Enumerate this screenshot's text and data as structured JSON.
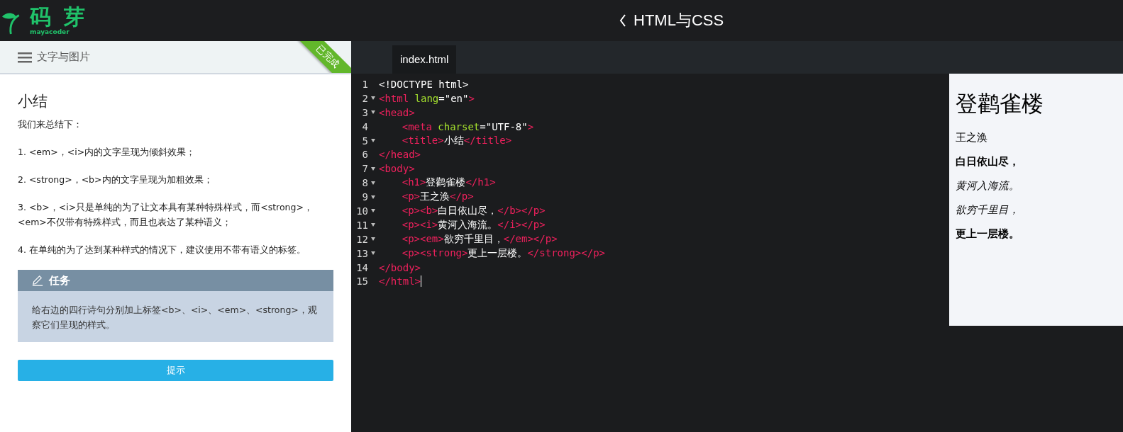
{
  "header": {
    "logo": {
      "name": "码 芽",
      "subtitle": "mayacoder"
    },
    "title": "HTML与CSS"
  },
  "lesson": {
    "menu_title": "文字与图片",
    "completed": true,
    "ribbon": "已完成",
    "heading": "小结",
    "paragraphs": [
      "我们来总结下：",
      "1. <em>，<i>内的文字呈现为倾斜效果；",
      "2. <strong>，<b>内的文字呈现为加粗效果；",
      "3. <b>，<i>只是单纯的为了让文本具有某种特殊样式，而<strong>，<em>不仅带有特殊样式，而且也表达了某种语义；",
      "4. 在单纯的为了达到某种样式的情况下，建议使用不带有语义的标签。"
    ],
    "task": {
      "title": "任务",
      "text": "给右边的四行诗句分别加上标签<b>、<i>、<em>、<strong>，观察它们呈现的样式。"
    },
    "hint_button": "提示"
  },
  "editor": {
    "tabs": [
      {
        "label": "index.html",
        "selected": true
      }
    ],
    "lines": [
      {
        "number": "1",
        "foldable": false,
        "indented": false,
        "tokens": [
          {
            "kind": "plain",
            "text": "<!DOCTYPE html>"
          }
        ]
      },
      {
        "number": "2",
        "foldable": true,
        "indented": false,
        "tokens": [
          {
            "kind": "tag",
            "text": "<html"
          },
          {
            "kind": "attr",
            "text": "lang"
          },
          {
            "kind": "plain",
            "text": "=\"en\""
          },
          {
            "kind": "tag",
            "text": ">"
          }
        ]
      },
      {
        "number": "3",
        "foldable": true,
        "indented": false,
        "tokens": [
          {
            "kind": "tag",
            "text": "<head>"
          }
        ]
      },
      {
        "number": "4",
        "foldable": false,
        "indented": true,
        "tokens": [
          {
            "kind": "tag",
            "text": "<meta"
          },
          {
            "kind": "attr",
            "text": "charset"
          },
          {
            "kind": "plain",
            "text": "=\"UTF-8\""
          },
          {
            "kind": "tag",
            "text": ">"
          }
        ]
      },
      {
        "number": "5",
        "foldable": true,
        "indented": true,
        "tokens": [
          {
            "kind": "tag",
            "text": "<title>"
          },
          {
            "kind": "plain",
            "text": "小结"
          },
          {
            "kind": "tag",
            "text": "</title>"
          }
        ]
      },
      {
        "number": "6",
        "foldable": false,
        "indented": false,
        "tokens": [
          {
            "kind": "tag",
            "text": "</head>"
          }
        ]
      },
      {
        "number": "7",
        "foldable": true,
        "indented": false,
        "tokens": [
          {
            "kind": "tag",
            "text": "<body>"
          }
        ]
      },
      {
        "number": "8",
        "foldable": true,
        "indented": true,
        "tokens": [
          {
            "kind": "tag",
            "text": "<h1>"
          },
          {
            "kind": "plain",
            "text": "登鹳雀楼"
          },
          {
            "kind": "tag",
            "text": "</h1>"
          }
        ]
      },
      {
        "number": "9",
        "foldable": true,
        "indented": true,
        "tokens": [
          {
            "kind": "tag",
            "text": "<p>"
          },
          {
            "kind": "plain",
            "text": "王之涣"
          },
          {
            "kind": "tag",
            "text": "</p>"
          }
        ]
      },
      {
        "number": "10",
        "foldable": true,
        "indented": true,
        "tokens": [
          {
            "kind": "tag",
            "text": "<p><b>"
          },
          {
            "kind": "plain",
            "text": "白日依山尽，"
          },
          {
            "kind": "tag",
            "text": "</b></p>"
          }
        ]
      },
      {
        "number": "11",
        "foldable": true,
        "indented": true,
        "tokens": [
          {
            "kind": "tag",
            "text": "<p><i>"
          },
          {
            "kind": "plain",
            "text": "黄河入海流。"
          },
          {
            "kind": "tag",
            "text": "</i></p>"
          }
        ]
      },
      {
        "number": "12",
        "foldable": true,
        "indented": true,
        "tokens": [
          {
            "kind": "tag",
            "text": "<p><em>"
          },
          {
            "kind": "plain",
            "text": "欲穷千里目，"
          },
          {
            "kind": "tag",
            "text": "</em></p>"
          }
        ]
      },
      {
        "number": "13",
        "foldable": true,
        "indented": true,
        "tokens": [
          {
            "kind": "tag",
            "text": "<p><strong>"
          },
          {
            "kind": "plain",
            "text": "更上一层楼。"
          },
          {
            "kind": "tag",
            "text": "</strong></p>"
          }
        ]
      },
      {
        "number": "14",
        "foldable": false,
        "indented": false,
        "tokens": [
          {
            "kind": "tag",
            "text": "</body>"
          }
        ]
      },
      {
        "number": "15",
        "foldable": false,
        "indented": false,
        "cursor": true,
        "tokens": [
          {
            "kind": "tag",
            "text": "</html>"
          }
        ]
      }
    ]
  },
  "preview": [
    {
      "kind": "h1",
      "text": "登鹳雀楼"
    },
    {
      "kind": "p",
      "text": "王之涣"
    },
    {
      "kind": "b",
      "text": "白日依山尽，"
    },
    {
      "kind": "i",
      "text": "黄河入海流。"
    },
    {
      "kind": "em",
      "text": "欲穷千里目，"
    },
    {
      "kind": "strong",
      "text": "更上一层楼。"
    }
  ]
}
